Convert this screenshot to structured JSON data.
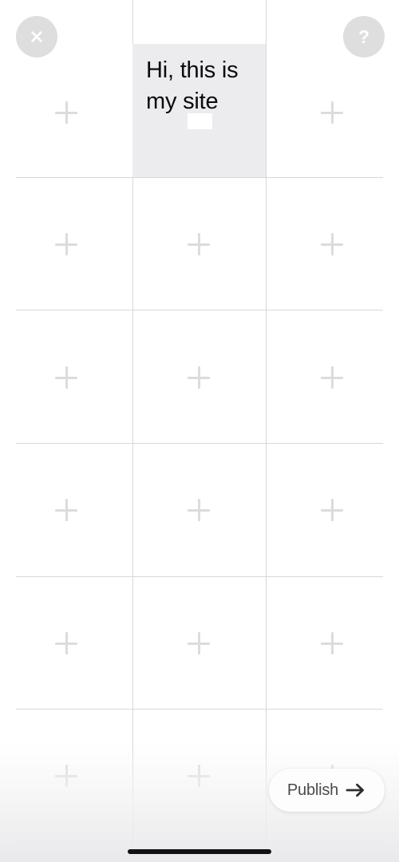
{
  "screen": {
    "name": "site-builder-editor",
    "background_color": "#ffffff"
  },
  "toolbar": {
    "close_button": {
      "label": "Close",
      "icon": "close-icon",
      "background_color": "#dededf",
      "icon_color": "#ffffff"
    },
    "help_button": {
      "label": "Help",
      "glyph": "?",
      "icon": "question-mark-icon",
      "background_color": "#dededf",
      "icon_color": "#ffffff"
    }
  },
  "canvas": {
    "text_block": {
      "content": "Hi, this is my site",
      "background_color": "#ececee",
      "text_color": "#0b0b0c",
      "selected": true
    },
    "grid": {
      "columns": 3,
      "rows": 6,
      "line_color": "#d8d8da",
      "add_icon": "plus-icon",
      "add_icon_color": "#dcdcde",
      "add_slots": [
        {
          "label": "Add block",
          "column": 1,
          "row": 1
        },
        {
          "label": "Add block",
          "column": 3,
          "row": 1
        },
        {
          "label": "Add block",
          "column": 1,
          "row": 2
        },
        {
          "label": "Add block",
          "column": 2,
          "row": 2
        },
        {
          "label": "Add block",
          "column": 3,
          "row": 2
        },
        {
          "label": "Add block",
          "column": 1,
          "row": 3
        },
        {
          "label": "Add block",
          "column": 2,
          "row": 3
        },
        {
          "label": "Add block",
          "column": 3,
          "row": 3
        },
        {
          "label": "Add block",
          "column": 1,
          "row": 4
        },
        {
          "label": "Add block",
          "column": 2,
          "row": 4
        },
        {
          "label": "Add block",
          "column": 3,
          "row": 4
        },
        {
          "label": "Add block",
          "column": 1,
          "row": 5
        },
        {
          "label": "Add block",
          "column": 2,
          "row": 5
        },
        {
          "label": "Add block",
          "column": 3,
          "row": 5
        },
        {
          "label": "Add block",
          "column": 1,
          "row": 6
        },
        {
          "label": "Add block",
          "column": 2,
          "row": 6
        },
        {
          "label": "Add block",
          "column": 3,
          "row": 6
        }
      ]
    }
  },
  "footer": {
    "publish_button": {
      "label": "Publish",
      "icon": "arrow-right-icon",
      "background_color": "#fdfdfd",
      "text_color": "#4a4a4c"
    }
  },
  "system": {
    "home_indicator": {
      "label": "Home indicator",
      "color": "#111113"
    }
  }
}
